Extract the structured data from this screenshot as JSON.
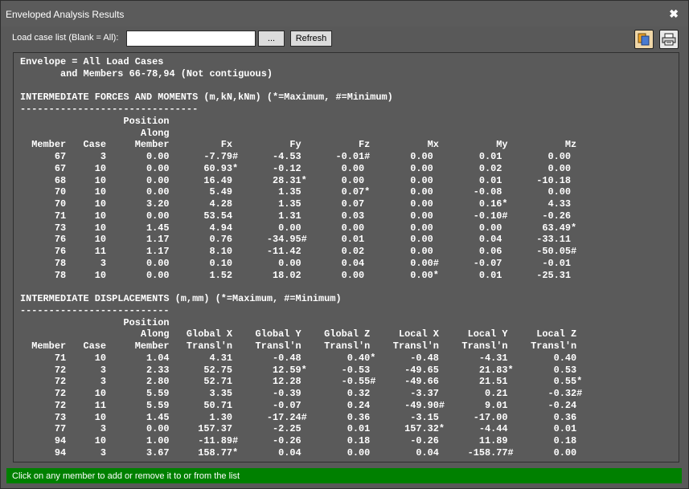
{
  "window": {
    "title": "Enveloped Analysis Results",
    "close_glyph": "✖"
  },
  "toolbar": {
    "load_case_label": "Load case list (Blank = All):",
    "load_case_value": "",
    "browse_label": "...",
    "refresh_label": "Refresh",
    "copy_icon": "copy-icon",
    "print_icon": "printer-icon"
  },
  "report": {
    "lines": [
      "Envelope = All Load Cases",
      "       and Members 66-78,94 (Not contiguous)",
      "",
      "INTERMEDIATE FORCES AND MOMENTS (m,kN,kNm) (*=Maximum, #=Minimum)",
      "-------------------------------",
      "                  Position",
      "                     Along",
      "  Member   Case     Member         Fx          Fy          Fz          Mx          My          Mz",
      "      67      3       0.00      -7.79#      -4.53      -0.01#       0.00        0.01        0.00",
      "      67     10       0.00      60.93*      -0.12       0.00        0.00        0.02        0.00",
      "      68     10       0.00      16.49       28.31*      0.00        0.00        0.01      -10.18",
      "      70     10       0.00       5.49        1.35       0.07*       0.00       -0.08        0.00",
      "      70     10       3.20       4.28        1.35       0.07        0.00        0.16*       4.33",
      "      71     10       0.00      53.54        1.31       0.03        0.00       -0.10#      -0.26",
      "      73     10       1.45       4.94        0.00       0.00        0.00        0.00       63.49*",
      "      76     10       1.17       0.76      -34.95#      0.01        0.00        0.04      -33.11",
      "      76     11       1.17       8.10      -11.42       0.02        0.00        0.06      -50.05#",
      "      78      3       0.00       0.10        0.00       0.04        0.00#      -0.07       -0.01",
      "      78     10       0.00       1.52       18.02       0.00        0.00*       0.01      -25.31",
      "",
      "INTERMEDIATE DISPLACEMENTS (m,mm) (*=Maximum, #=Minimum)",
      "--------------------------",
      "                  Position",
      "                     Along   Global X    Global Y    Global Z     Local X     Local Y     Local Z",
      "  Member   Case     Member   Transl'n    Transl'n    Transl'n    Transl'n    Transl'n    Transl'n",
      "      71     10       1.04       4.31       -0.48        0.40*      -0.48       -4.31        0.40",
      "      72      3       2.33      52.75       12.59*      -0.53      -49.65       21.83*       0.53",
      "      72      3       2.80      52.71       12.28       -0.55#     -49.66       21.51        0.55*",
      "      72     10       5.59       3.35       -0.39        0.32       -3.37        0.21       -0.32#",
      "      72     11       5.59      50.71       -0.07        0.24      -49.90#       9.01       -0.24",
      "      73     10       1.45       1.30      -17.24#       0.36       -3.15      -17.00        0.36",
      "      77      3       0.00     157.37       -2.25        0.01      157.32*      -4.44        0.01",
      "      94     10       1.00     -11.89#      -0.26        0.18       -0.26       11.89        0.18",
      "      94      3       3.67     158.77*       0.04        0.00        0.04     -158.77#       0.00"
    ]
  },
  "status": {
    "text": "Click on any member to add or remove it to or from the list",
    "color": "#008000"
  }
}
